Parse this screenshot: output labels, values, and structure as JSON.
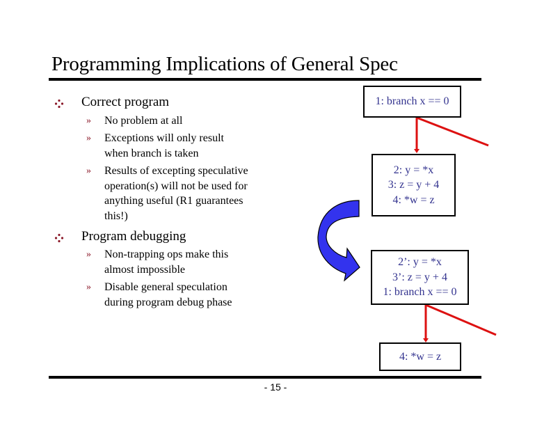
{
  "slide": {
    "title": "Programming Implications of General Spec",
    "page_number": "- 15 -",
    "bullets": [
      {
        "label": "Correct  program",
        "sub": [
          "No problem at all",
          "Exceptions will only result when branch is taken",
          "Results of excepting speculative operation(s) will not be used for anything useful (R1 guarantees this!)"
        ]
      },
      {
        "label": "Program debugging",
        "sub": [
          "Non-trapping ops make this almost impossible",
          "Disable general speculation during program debug phase"
        ]
      }
    ],
    "sub_marker": "»",
    "diagram": {
      "before": {
        "branch_box": [
          "1: branch x == 0"
        ],
        "body_box": [
          "2: y = *x",
          "3: z = y + 4",
          "4: *w = z"
        ]
      },
      "after": {
        "hoisted_box": [
          "2’: y = *x",
          "3’: z = y + 4",
          "1: branch x == 0"
        ],
        "tail_box": [
          "4: *w = z"
        ]
      },
      "colors": {
        "edge": "#dd1111",
        "arrow_fill": "#3333ee",
        "box_text": "#33338f",
        "bullet": "#8b1a2a"
      }
    }
  }
}
